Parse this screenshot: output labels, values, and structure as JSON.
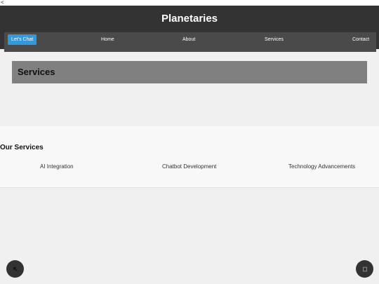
{
  "browser": {
    "back_glyph": "<"
  },
  "header": {
    "brand": "Planetaries"
  },
  "nav": {
    "cta": "Let's Chat",
    "links": [
      "Home",
      "About",
      "Services",
      "Contact"
    ]
  },
  "page": {
    "title": "Services"
  },
  "services": {
    "heading": "Our Services",
    "items": [
      "AI Integration",
      "Chatbot Development",
      "Technology Advancements"
    ]
  },
  "colors": {
    "header_bg": "#333333",
    "accent": "#3498db",
    "title_box_bg": "#808080"
  },
  "icons": {
    "left_fab": "arrow-icon",
    "right_fab": "square-icon"
  }
}
